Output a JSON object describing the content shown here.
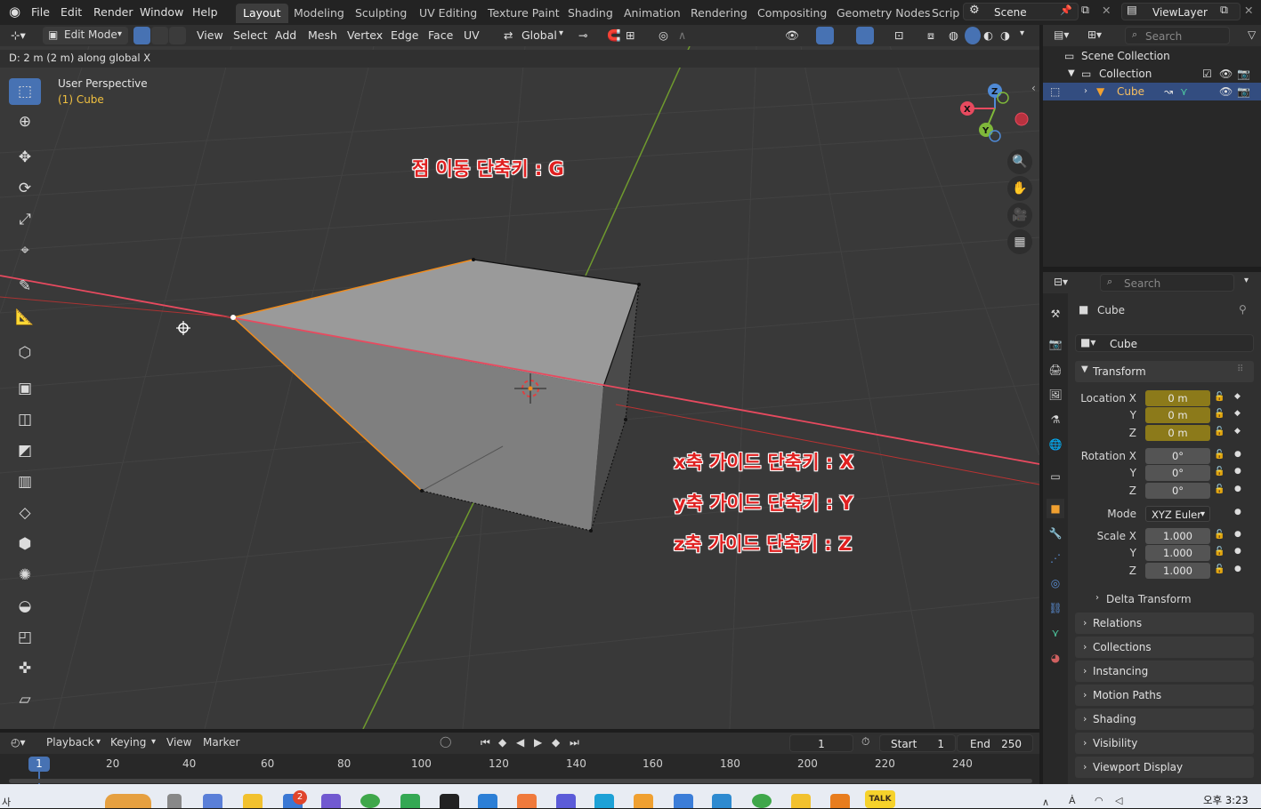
{
  "menubar": {
    "items": [
      "File",
      "Edit",
      "Render",
      "Window",
      "Help"
    ],
    "workspaces": [
      "Layout",
      "Modeling",
      "Sculpting",
      "UV Editing",
      "Texture Paint",
      "Shading",
      "Animation",
      "Rendering",
      "Compositing",
      "Geometry Nodes",
      "Scrip"
    ],
    "active_workspace": "Layout",
    "scene": "Scene",
    "view_layer": "ViewLayer"
  },
  "viewport_header": {
    "mode": "Edit Mode",
    "menus": [
      "View",
      "Select",
      "Add",
      "Mesh",
      "Vertex",
      "Edge",
      "Face",
      "UV"
    ],
    "orientation": "Global"
  },
  "viewport": {
    "status": "D: 2 m (2 m) along global X",
    "perspective": "User Perspective",
    "object_label": "(1) Cube",
    "gizmo": {
      "x": "X",
      "y": "Y",
      "z": "Z"
    }
  },
  "annotations": {
    "move_vertex": "점 이동 단축키 : G",
    "x_guide": "x축 가이드 단축키  : X",
    "y_guide": "y축 가이드 단축키  : Y",
    "z_guide": "z축 가이드 단축키  : Z"
  },
  "outliner": {
    "search_placeholder": "Search",
    "scene_collection": "Scene Collection",
    "collection": "Collection",
    "object": "Cube"
  },
  "properties": {
    "search_placeholder": "Search",
    "object_name": "Cube",
    "datablock": "Cube",
    "transform_header": "Transform",
    "location_label": "Location X",
    "rotation_label": "Rotation X",
    "scale_label": "Scale X",
    "y_label": "Y",
    "z_label": "Z",
    "location": [
      "0 m",
      "0 m",
      "0 m"
    ],
    "rotation": [
      "0°",
      "0°",
      "0°"
    ],
    "mode_label": "Mode",
    "mode_value": "XYZ Euler",
    "scale": [
      "1.000",
      "1.000",
      "1.000"
    ],
    "delta": "Delta Transform",
    "panels": [
      "Relations",
      "Collections",
      "Instancing",
      "Motion Paths",
      "Shading",
      "Visibility",
      "Viewport Display"
    ]
  },
  "timeline": {
    "menus": [
      "Playback",
      "Keying",
      "View",
      "Marker"
    ],
    "current_frame": "1",
    "start_label": "Start",
    "start": "1",
    "end_label": "End",
    "end": "250",
    "ticks": [
      "20",
      "40",
      "60",
      "80",
      "100",
      "120",
      "140",
      "160",
      "180",
      "200",
      "220",
      "240"
    ],
    "playhead": "1"
  },
  "taskbar": {
    "left_text": "사",
    "badge": "2",
    "time": "오후 3:23",
    "talk": "TALK"
  },
  "colors": {
    "accent": "#4772b3",
    "x_axis": "#e84a5f",
    "y_axis": "#7fb83a",
    "selected_edge": "#f08c1d",
    "annotation": "#e02020"
  }
}
